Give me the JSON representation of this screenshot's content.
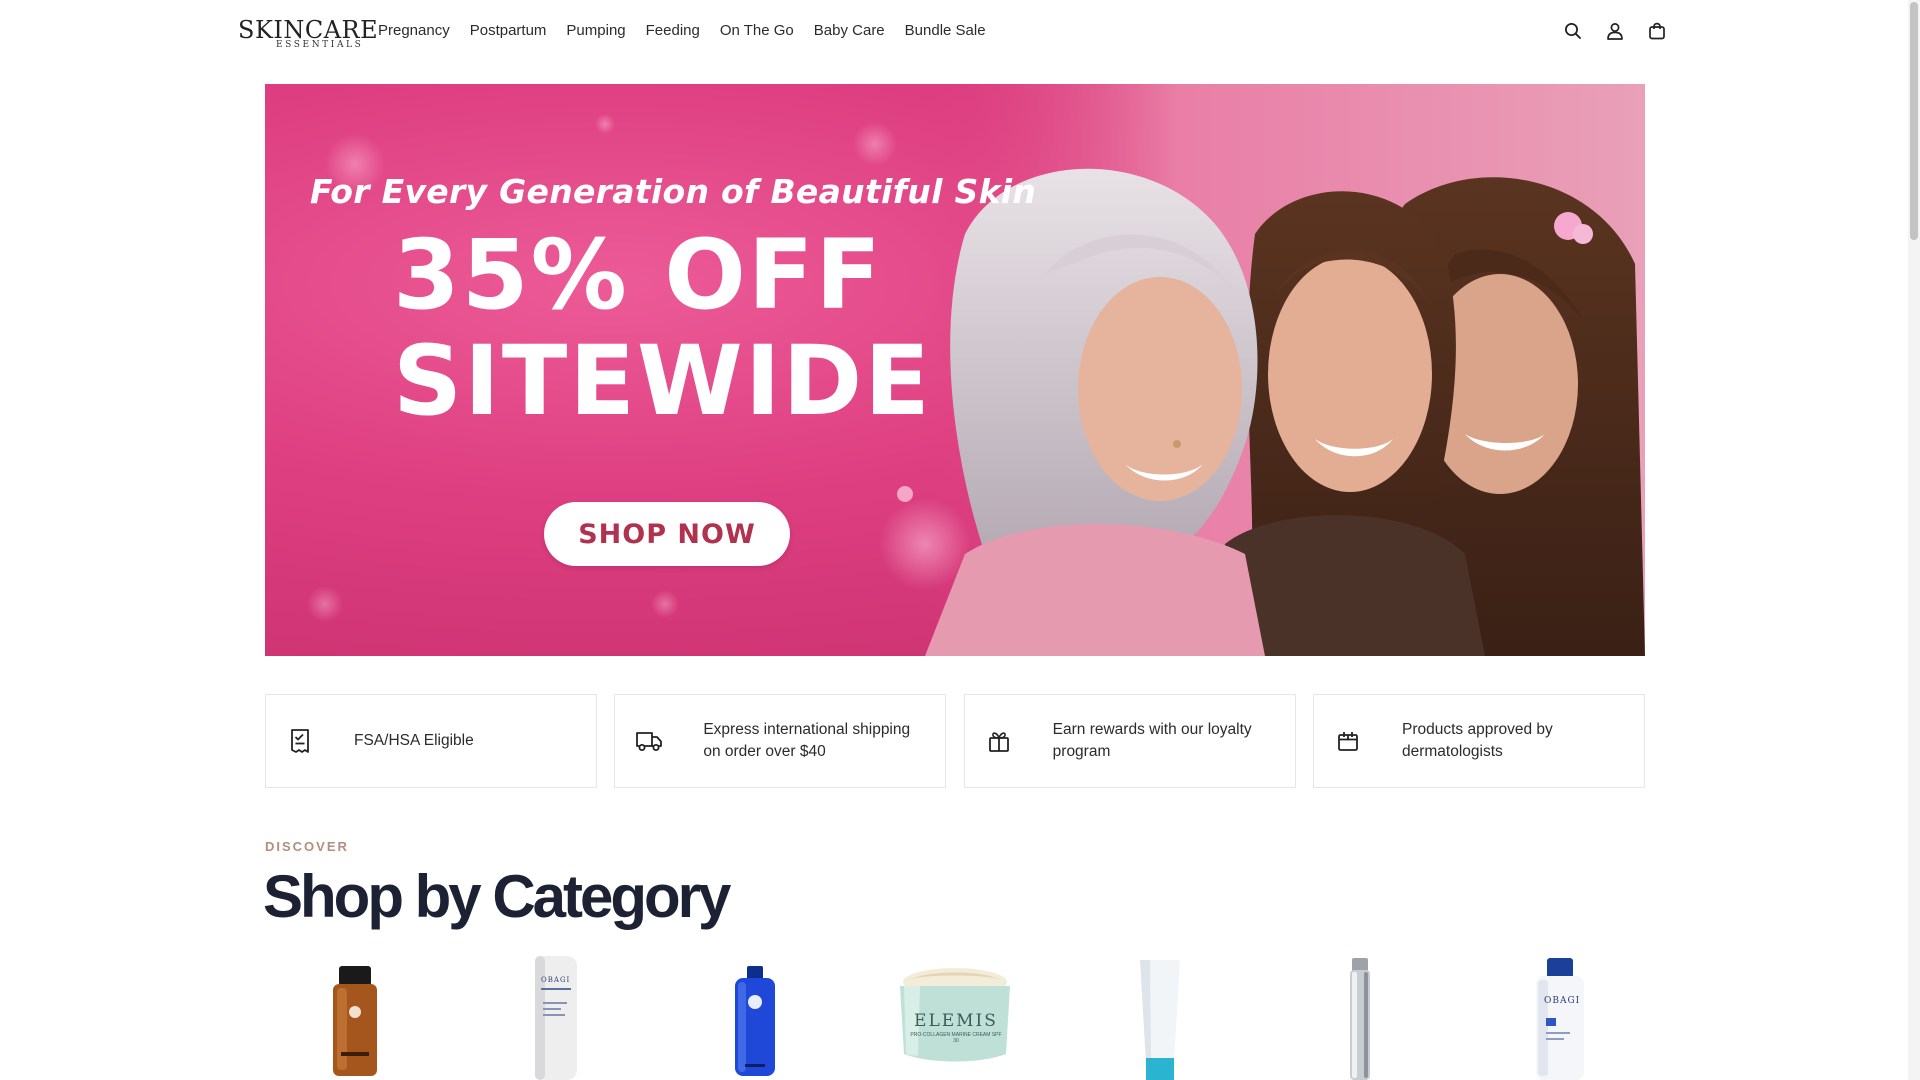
{
  "brand": {
    "logo_top": "SKINCARE",
    "logo_bottom": "ESSENTIALS"
  },
  "nav": {
    "items": [
      {
        "label": "Pregnancy"
      },
      {
        "label": "Postpartum"
      },
      {
        "label": "Pumping"
      },
      {
        "label": "Feeding"
      },
      {
        "label": "On The Go"
      },
      {
        "label": "Baby Care"
      },
      {
        "label": "Bundle Sale"
      }
    ]
  },
  "header_icons": [
    "search-icon",
    "account-icon",
    "cart-icon"
  ],
  "hero": {
    "tagline": "For Every Generation of Beautiful Skin",
    "headline_1": "35% OFF",
    "headline_2": "SITEWIDE",
    "cta": "SHOP NOW",
    "colors": {
      "background": "#de3f80",
      "cta_text": "#b0324f"
    }
  },
  "features": [
    {
      "icon": "receipt-check-icon",
      "text": "FSA/HSA Eligible"
    },
    {
      "icon": "truck-icon",
      "text": "Express international shipping on order over $40"
    },
    {
      "icon": "gift-icon",
      "text": "Earn rewards with our loyalty program"
    },
    {
      "icon": "calendar-box-icon",
      "text": "Products approved by dermatologists"
    }
  ],
  "category": {
    "eyebrow": "DISCOVER",
    "title": "Shop by Category",
    "products": [
      {
        "name": "amber-serum-bottle"
      },
      {
        "name": "obagi-pump-bottle",
        "label": "OBAGI"
      },
      {
        "name": "blue-cleanser-bottle"
      },
      {
        "name": "elemis-cream-jar",
        "label": "ELEMIS",
        "sublabel": "PRO-COLLAGEN MARINE CREAM SPF 30"
      },
      {
        "name": "white-tube"
      },
      {
        "name": "silver-slim-pump"
      },
      {
        "name": "obagi-white-bottle",
        "label": "OBAGI"
      }
    ]
  }
}
